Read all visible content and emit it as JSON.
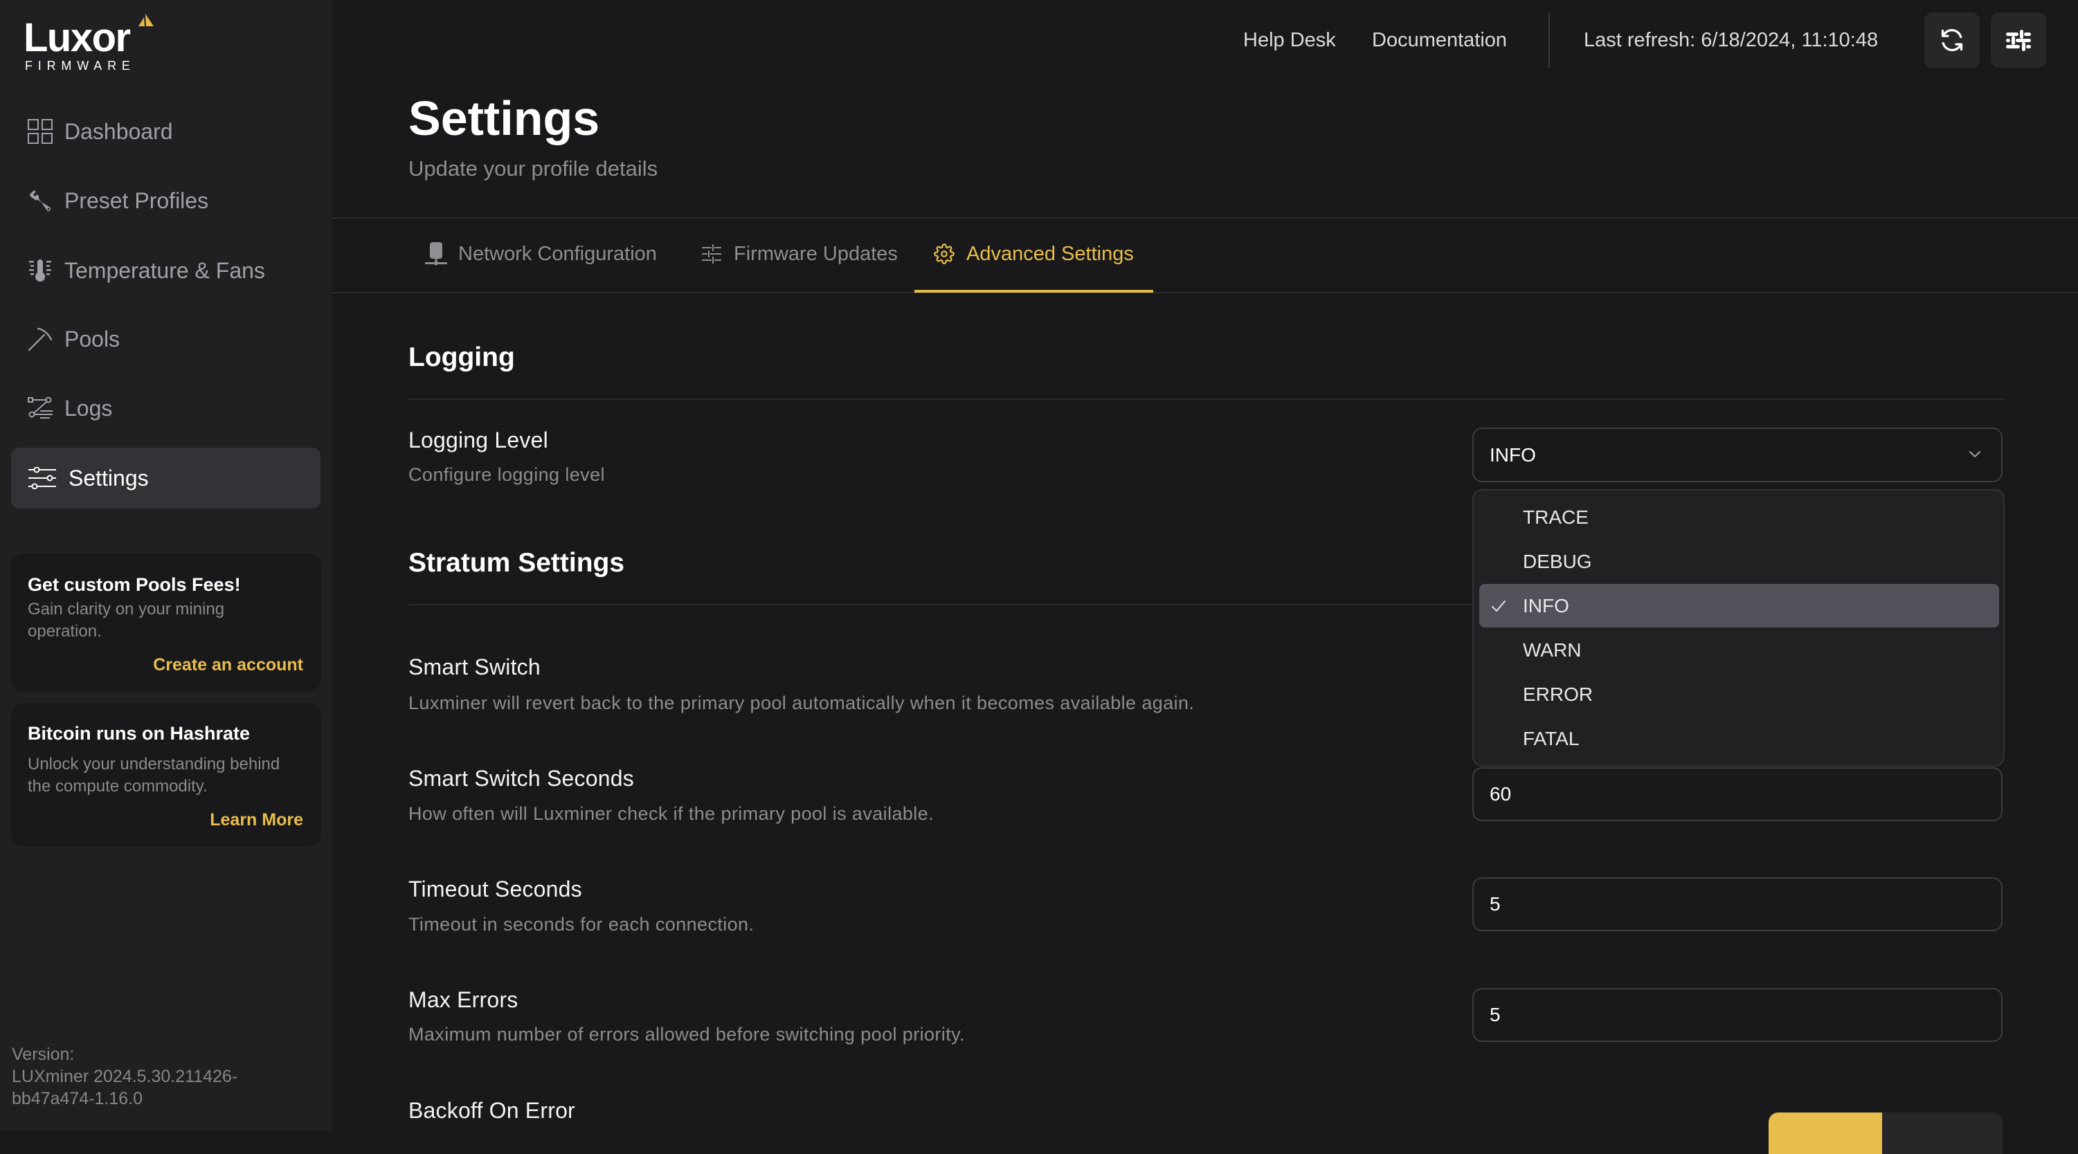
{
  "brand": {
    "name": "Luxor",
    "sub": "FIRMWARE",
    "accent_color": "#e8bd4c"
  },
  "sidebar": {
    "items": [
      {
        "label": "Dashboard",
        "icon": "dashboard-icon",
        "active": false
      },
      {
        "label": "Preset Profiles",
        "icon": "wrench-icon",
        "active": false
      },
      {
        "label": "Temperature & Fans",
        "icon": "thermometer-icon",
        "active": false
      },
      {
        "label": "Pools",
        "icon": "pickaxe-icon",
        "active": false
      },
      {
        "label": "Logs",
        "icon": "logs-icon",
        "active": false
      },
      {
        "label": "Settings",
        "icon": "sliders-icon",
        "active": true
      }
    ],
    "promos": [
      {
        "title": "Get custom Pools Fees!",
        "description": "Gain clarity on your mining operation.",
        "link": "Create an account"
      },
      {
        "title": "Bitcoin runs on Hashrate",
        "description": "Unlock your understanding behind the compute commodity.",
        "link": "Learn More"
      }
    ],
    "version": {
      "label": "Version:",
      "value": "LUXminer 2024.5.30.211426-bb47a474-1.16.0"
    }
  },
  "header": {
    "links": [
      "Help Desk",
      "Documentation"
    ],
    "last_refresh": "Last refresh: 6/18/2024, 11:10:48",
    "buttons": [
      {
        "icon": "refresh-icon"
      },
      {
        "icon": "sliders-icon"
      }
    ]
  },
  "page": {
    "title": "Settings",
    "subtitle": "Update your profile details"
  },
  "tabs": [
    {
      "label": "Network Configuration",
      "icon": "network-icon",
      "active": false
    },
    {
      "label": "Firmware Updates",
      "icon": "sliders-icon",
      "active": false
    },
    {
      "label": "Advanced Settings",
      "icon": "gear-icon",
      "active": true
    }
  ],
  "logging": {
    "title": "Logging",
    "level": {
      "label": "Logging Level",
      "description": "Configure logging level",
      "value": "INFO",
      "dropdown_open": true,
      "options": [
        "TRACE",
        "DEBUG",
        "INFO",
        "WARN",
        "ERROR",
        "FATAL"
      ],
      "selected_index": 2
    }
  },
  "stratum": {
    "title": "Stratum Settings",
    "smart_switch": {
      "label": "Smart Switch",
      "description": "Luxminer will revert back to the primary pool automatically when it becomes available again."
    },
    "smart_switch_seconds": {
      "label": "Smart Switch Seconds",
      "description": "How often will Luxminer check if the primary pool is available.",
      "value": "60"
    },
    "timeout_seconds": {
      "label": "Timeout Seconds",
      "description": "Timeout in seconds for each connection.",
      "value": "5"
    },
    "max_errors": {
      "label": "Max Errors",
      "description": "Maximum number of errors allowed before switching pool priority.",
      "value": "5"
    },
    "backoff_on_error": {
      "label": "Backoff On Error",
      "control": "toggle"
    }
  }
}
